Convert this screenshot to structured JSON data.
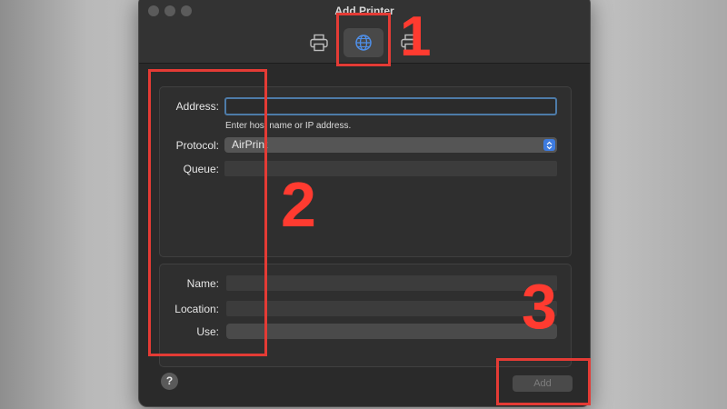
{
  "window": {
    "title": "Add Printer"
  },
  "toolbar": {
    "items": [
      {
        "icon": "printer-icon",
        "active": false
      },
      {
        "icon": "globe-icon",
        "active": true
      },
      {
        "icon": "windows-printer-icon",
        "active": false
      }
    ]
  },
  "form": {
    "address_label": "Address:",
    "address_value": "",
    "address_hint": "Enter host name or IP address.",
    "protocol_label": "Protocol:",
    "protocol_value": "AirPrint",
    "queue_label": "Queue:",
    "queue_value": ""
  },
  "details": {
    "name_label": "Name:",
    "name_value": "",
    "location_label": "Location:",
    "location_value": "",
    "use_label": "Use:",
    "use_value": ""
  },
  "footer": {
    "help_label": "?",
    "add_label": "Add"
  },
  "annotations": {
    "n1": "1",
    "n2": "2",
    "n3": "3"
  },
  "colors": {
    "annotation": "#e43b35",
    "accent": "#3d7be0",
    "focus_ring": "#4d7ba8"
  }
}
